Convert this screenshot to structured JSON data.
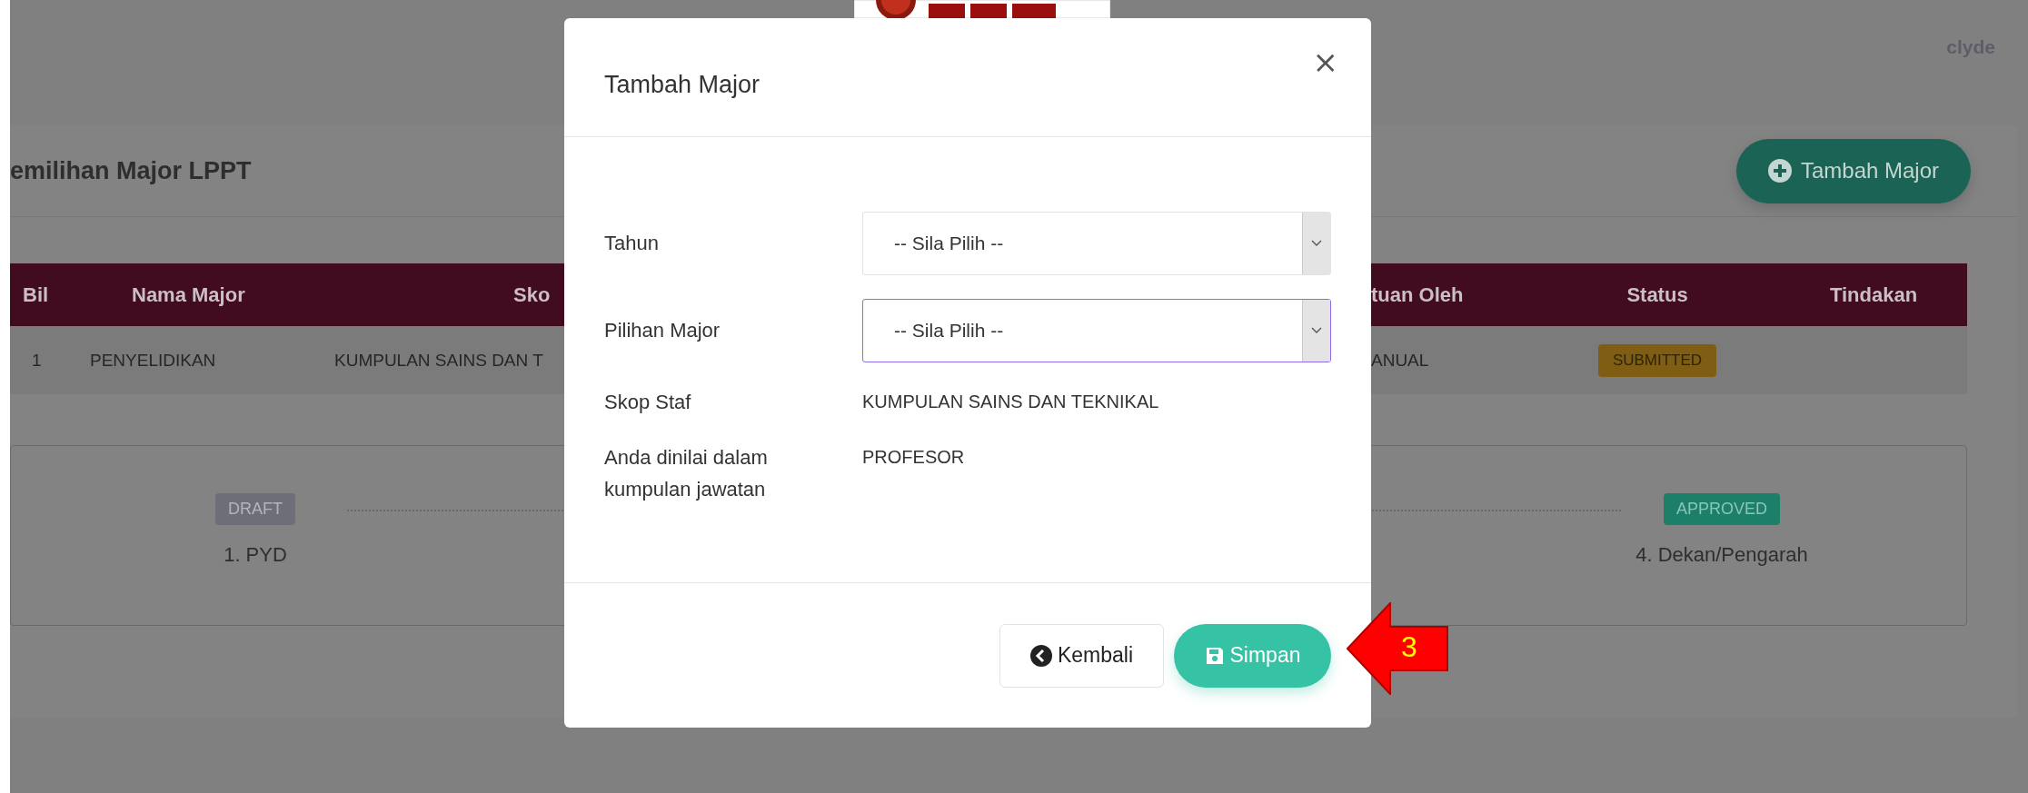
{
  "header": {
    "user": "clyde"
  },
  "page": {
    "title": "emilihan Major LPPT",
    "add_button": "Tambah Major"
  },
  "table": {
    "columns": [
      "Bil",
      "Nama Major",
      "Sko",
      "tuan Oleh",
      "Status",
      "Tindakan"
    ],
    "rows": [
      {
        "cells": [
          "1",
          "PENYELIDIKAN",
          "KUMPULAN SAINS DAN T",
          "ANUAL"
        ],
        "status": "SUBMITTED"
      }
    ]
  },
  "steps": [
    {
      "kind": "draft",
      "badge": "DRAFT",
      "label": "1. PYD"
    },
    {
      "kind": "approved",
      "badge": "APPROVED",
      "label": "4. Dekan/Pengarah"
    }
  ],
  "modal": {
    "title": "Tambah Major",
    "close": "×",
    "selects": [
      {
        "label": "Tahun",
        "value": "-- Sila Pilih --",
        "focused": false
      },
      {
        "label": "Pilihan Major",
        "value": "-- Sila Pilih --",
        "focused": true
      }
    ],
    "info": [
      {
        "label": "Skop Staf",
        "value": "KUMPULAN SAINS DAN TEKNIKAL"
      },
      {
        "label": "Anda dinilai dalam kumpulan jawatan",
        "value": "PROFESOR"
      }
    ],
    "buttons": [
      {
        "kind": "back",
        "label": "Kembali"
      },
      {
        "kind": "save",
        "label": "Simpan"
      }
    ]
  },
  "annotation": {
    "label": "3"
  }
}
